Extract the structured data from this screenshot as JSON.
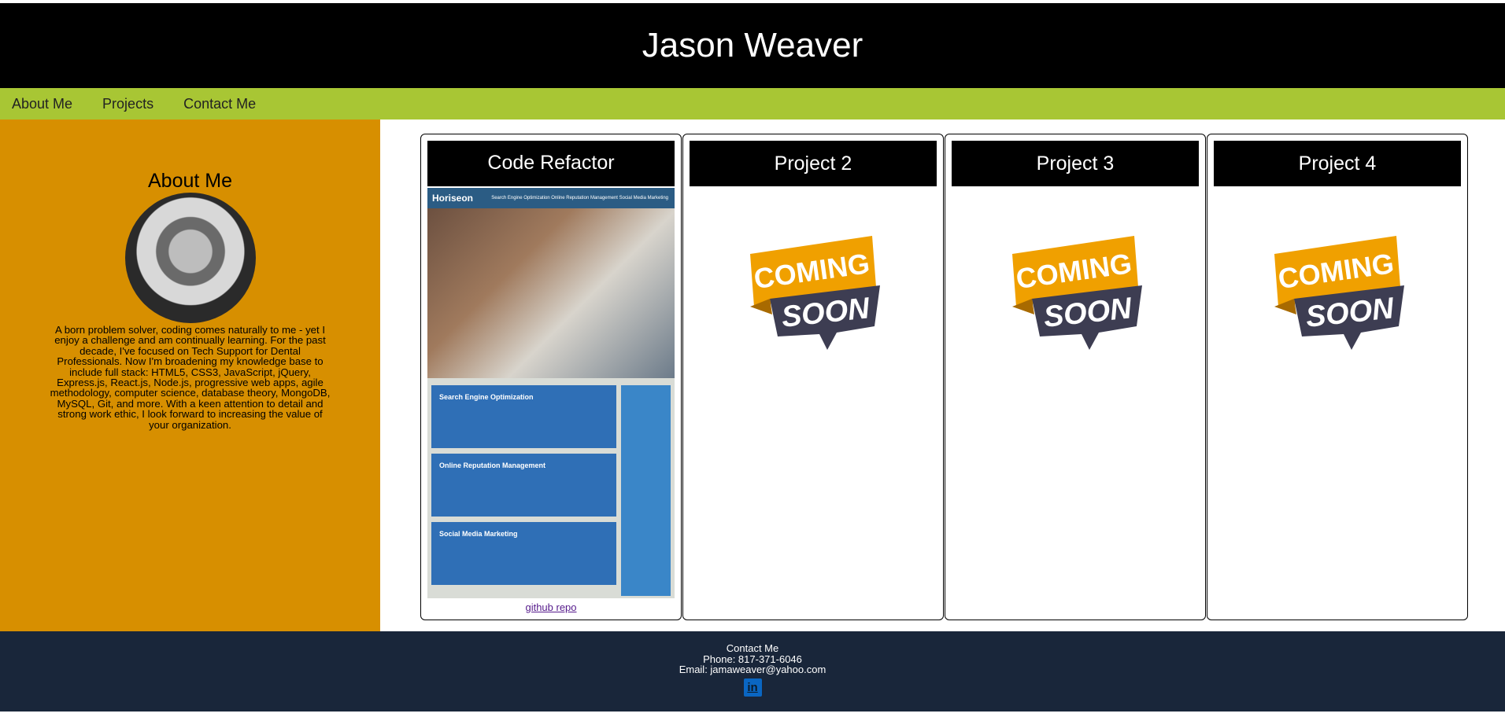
{
  "header": {
    "title": "Jason Weaver"
  },
  "nav": {
    "items": [
      "About Me",
      "Projects",
      "Contact Me"
    ]
  },
  "about": {
    "heading": "About Me",
    "bio": "A born problem solver, coding comes naturally to me - yet I enjoy a challenge and am continually learning. For the past decade, I've focused on Tech Support for Dental Professionals. Now I'm broadening my knowledge base to include full stack: HTML5, CSS3, JavaScript, jQuery, Express.js, React.js, Node.js, progressive web apps, agile methodology, computer science, database theory, MongoDB, MySQL, Git, and more. With a keen attention to detail and strong work ethic, I look forward to increasing the value of your organization."
  },
  "projects": [
    {
      "title": "Code Refactor",
      "link": "github repo",
      "screenshot": {
        "brand": "Horiseon",
        "nav": "Search Engine Optimization    Online Reputation Management    Social Media Marketing",
        "boxes": [
          "Search Engine Optimization",
          "Online Reputation Management",
          "Social Media Marketing"
        ]
      }
    },
    {
      "title": "Project 2",
      "image": "coming-soon-banner",
      "banner_top": "COMING",
      "banner_bottom": "SOON"
    },
    {
      "title": "Project 3",
      "image": "coming-soon-banner",
      "banner_top": "COMING",
      "banner_bottom": "SOON"
    },
    {
      "title": "Project 4",
      "image": "coming-soon-banner",
      "banner_top": "COMING",
      "banner_bottom": "SOON"
    }
  ],
  "footer": {
    "heading": "Contact Me",
    "phone": "Phone: 817-371-6046",
    "email": "Email: jamaweaver@yahoo.com",
    "linkedin_icon": "linkedin-icon",
    "linkedin_glyph": "in"
  },
  "colors": {
    "header_bg": "#000000",
    "nav_bg": "#a8c634",
    "about_bg": "#d78f00",
    "footer_bg": "#19263a",
    "banner_orange": "#f0a000",
    "banner_dark": "#3d3d52"
  }
}
